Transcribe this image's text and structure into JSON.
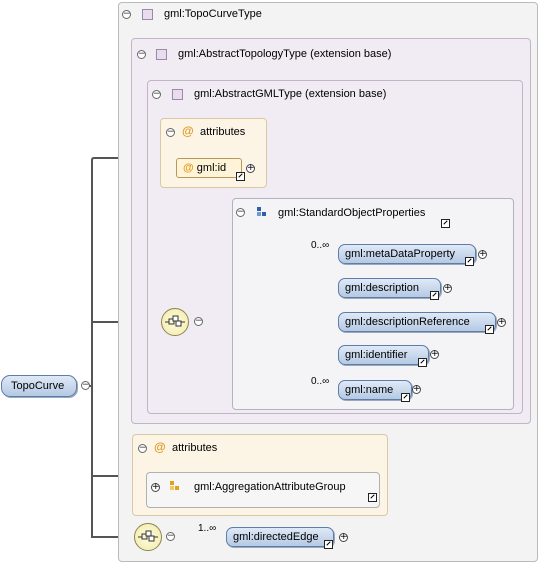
{
  "root": {
    "label": "TopoCurve"
  },
  "topo_curve_type": {
    "title": "gml:TopoCurveType"
  },
  "abstract_topology": {
    "title": "gml:AbstractTopologyType (extension base)"
  },
  "abstract_gml": {
    "title": "gml:AbstractGMLType (extension base)"
  },
  "gml_attributes": {
    "title": "attributes",
    "id_label": "gml:id"
  },
  "standard_props": {
    "title": "gml:StandardObjectProperties",
    "elements": [
      {
        "label": "gml:metaDataProperty",
        "cardinality": "0..∞"
      },
      {
        "label": "gml:description",
        "cardinality": ""
      },
      {
        "label": "gml:descriptionReference",
        "cardinality": ""
      },
      {
        "label": "gml:identifier",
        "cardinality": ""
      },
      {
        "label": "gml:name",
        "cardinality": "0..∞"
      }
    ]
  },
  "aggregation": {
    "title": "attributes",
    "group_label": "gml:AggregationAttributeGroup"
  },
  "directed_edge": {
    "label": "gml:directedEdge",
    "cardinality": "1..∞"
  },
  "colors": {
    "element_fill": "#c8d8ee",
    "attribute_fill": "#fcf5e6",
    "extension_fill": "#f1ecf3"
  },
  "icons": {
    "collapse": "minus-circle-icon",
    "expand": "plus-circle-icon",
    "link": "link-arrow-icon",
    "sequence": "sequence-compositor-icon"
  }
}
